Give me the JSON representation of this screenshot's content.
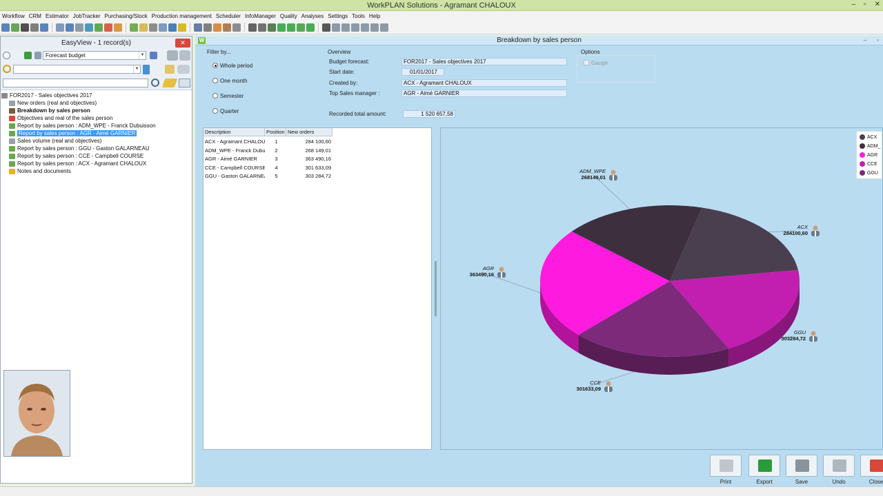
{
  "app": {
    "title": "WorkPLAN Solutions - Agramant CHALOUX",
    "win_min": "–",
    "win_max": "▫",
    "win_close": "✕"
  },
  "menu": [
    "Workflow",
    "CRM",
    "Estimator",
    "JobTracker",
    "Purchasing/Stock",
    "Production management",
    "Scheduler",
    "InfoManager",
    "Quality",
    "Analyses",
    "Settings",
    "Tools",
    "Help"
  ],
  "easyview": {
    "title": "EasyView - 1 record(s)",
    "close": "✕",
    "filter_value": "Forecast budget",
    "search_value": "",
    "tree": [
      {
        "label": "FOR2017 - Sales objectives 2017",
        "indent": 0,
        "icon_color": "#8a8a8a",
        "bold": false,
        "selected": false
      },
      {
        "label": "New orders (real and objectives)",
        "indent": 1,
        "icon_color": "#9aa0a6",
        "bold": false,
        "selected": false
      },
      {
        "label": "Breakdown by sales person",
        "indent": 1,
        "icon_color": "#7a5c3a",
        "bold": true,
        "selected": false
      },
      {
        "label": "Objectives and real of the sales person",
        "indent": 1,
        "icon_color": "#d9463b",
        "bold": false,
        "selected": false
      },
      {
        "label": "Report by sales person : ADM_WPE - Franck Dubuisson",
        "indent": 1,
        "icon_color": "#6aa84f",
        "bold": false,
        "selected": false
      },
      {
        "label": "Report by sales person : AGR - Aimé GARNIER",
        "indent": 1,
        "icon_color": "#6aa84f",
        "bold": false,
        "selected": true
      },
      {
        "label": "Sales volume (real and objectives)",
        "indent": 1,
        "icon_color": "#9aa0a6",
        "bold": false,
        "selected": false
      },
      {
        "label": "Report by sales person : GGU - Gaston GALARNEAU",
        "indent": 1,
        "icon_color": "#6aa84f",
        "bold": false,
        "selected": false
      },
      {
        "label": "Report by sales person : CCE - Campbell COURSE",
        "indent": 1,
        "icon_color": "#6aa84f",
        "bold": false,
        "selected": false
      },
      {
        "label": "Report by sales person : ACX - Agramant CHALOUX",
        "indent": 1,
        "icon_color": "#6aa84f",
        "bold": false,
        "selected": false
      },
      {
        "label": "Notes and documents",
        "indent": 1,
        "icon_color": "#e6b422",
        "bold": false,
        "selected": false
      }
    ]
  },
  "main": {
    "title": "Breakdown by sales person",
    "logo": "W",
    "filter": {
      "label": "Filter by...",
      "options": [
        "Whole period",
        "One month",
        "Semester",
        "Quarter"
      ],
      "selected_index": 0
    },
    "overview": {
      "label": "Overview",
      "budget_forecast_label": "Budget forecast:",
      "budget_forecast": "FOR2017 - Sales objectives 2017",
      "start_date_label": "Start date:",
      "start_date": "01/01/2017",
      "created_by_label": "Created by:",
      "created_by": "ACX - Agramant CHALOUX",
      "top_sales_label": "Top Sales manager :",
      "top_sales": "AGR - Aimé GARNIER",
      "recorded_total_label": "Recorded total amount:",
      "recorded_total": "1 520 657,58"
    },
    "options": {
      "label": "Options",
      "gauge_label": "Gauge"
    },
    "table": {
      "headers": [
        "Description",
        "Position",
        "New orders"
      ],
      "rows": [
        [
          "ACX - Agramant CHALOUX",
          "1",
          "284 100,60"
        ],
        [
          "ADM_WPE - Franck Dubuisson",
          "2",
          "268 149,01"
        ],
        [
          "AGR - Aimé GARNIER",
          "3",
          "363 490,16"
        ],
        [
          "CCE - Campbell COURSE",
          "4",
          "301 633,09"
        ],
        [
          "GGU - Gaston GALARNEAU",
          "5",
          "303 284,72"
        ]
      ]
    },
    "buttons": [
      "Print",
      "Export",
      "Save",
      "Undo",
      "Close"
    ]
  },
  "chart_data": {
    "type": "pie",
    "categories": [
      "ACX",
      "ADM_WPE",
      "AGR",
      "CCE",
      "GGU"
    ],
    "values": [
      284100.6,
      268149.01,
      363490.16,
      301633.09,
      303284.72
    ],
    "value_labels": [
      "284100,60",
      "268149,01",
      "363490,16",
      "301633,09",
      "303284,72"
    ],
    "colors": [
      "#4a3f4f",
      "#3e2f3f",
      "#ff1adf",
      "#c21fb0",
      "#7d2a7a"
    ],
    "legend": [
      "ACX",
      "ADM_",
      "AGR",
      "CCE",
      "GGU"
    ],
    "legend_position": "top-right",
    "style": "3d"
  }
}
